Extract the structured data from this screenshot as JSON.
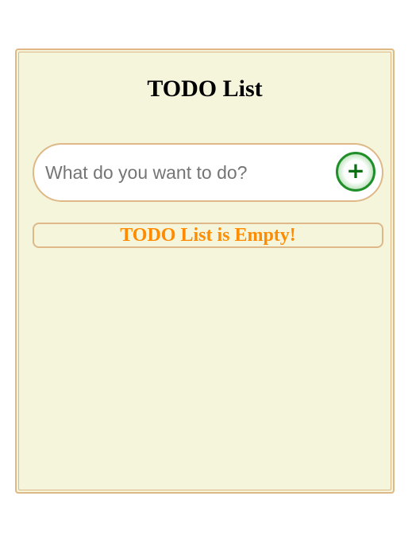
{
  "header": {
    "title": "TODO List"
  },
  "new_todo": {
    "placeholder": "What do you want to do?",
    "value": "",
    "add_button_symbol": "+",
    "add_button_icon": "plus-icon"
  },
  "list": {
    "items": [],
    "empty_message": "TODO List is Empty!"
  },
  "colors": {
    "page_background": "#ffffff",
    "panel_background": "#f5f5dc",
    "panel_border": "#deb887",
    "add_button_green": "#1f8f2a",
    "empty_message": "#ff8c00"
  }
}
